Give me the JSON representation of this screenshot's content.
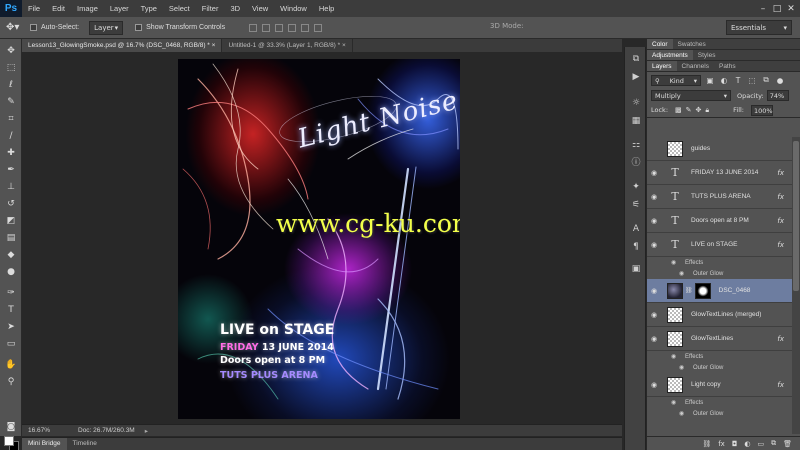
{
  "app": {
    "logo": "Ps",
    "menu": [
      "File",
      "Edit",
      "Image",
      "Layer",
      "Type",
      "Select",
      "Filter",
      "3D",
      "View",
      "Window",
      "Help"
    ],
    "window_controls": [
      "–",
      "□",
      "✕"
    ]
  },
  "options_bar": {
    "auto_select_label": "Auto-Select:",
    "auto_select_value": "Layer",
    "show_transform_label": "Show Transform Controls",
    "mode_3d_label": "3D Mode:",
    "workspace": "Essentials"
  },
  "document_tabs": [
    {
      "label": "Lesson13_GlowingSmoke.psd @ 16.7% (DSC_0468, RGB/8) *",
      "close": "×"
    },
    {
      "label": "Untitled-1 @ 33.3% (Layer 1, RGB/8) *",
      "close": "×"
    }
  ],
  "poster": {
    "title": "Light Noise",
    "watermark": "www.cg-ku.com",
    "line1": "LIVE on STAGE",
    "line2_accent": "FRIDAY",
    "line2_rest": " 13 JUNE 2014",
    "line3": "Doors open at 8 PM",
    "line4": "TUTS PLUS ARENA"
  },
  "status_bar": {
    "zoom": "16.67%",
    "doc_info": "Doc: 26.7M/260.3M"
  },
  "bottom_tabs": [
    "Mini Bridge",
    "Timeline"
  ],
  "panels": {
    "top_tabs": [
      "Color",
      "Swatches"
    ],
    "mid_tabs": [
      "Adjustments",
      "Styles"
    ],
    "layer_tabs": [
      "Layers",
      "Channels",
      "Paths"
    ],
    "kind": "Kind",
    "blend_mode": "Multiply",
    "opacity_label": "Opacity:",
    "opacity_value": "74%",
    "lock_label": "Lock:",
    "fill_label": "Fill:",
    "fill_value": "100%"
  },
  "layers": [
    {
      "name": "guides",
      "type": "pixel",
      "visible": false
    },
    {
      "name": "FRIDAY 13 JUNE 2014",
      "type": "text",
      "visible": true,
      "fx": "fx"
    },
    {
      "name": "TUTS PLUS ARENA",
      "type": "text",
      "visible": true,
      "fx": "fx"
    },
    {
      "name": "Doors open at 8 PM",
      "type": "text",
      "visible": true,
      "fx": "fx"
    },
    {
      "name": "LIVE on STAGE",
      "type": "text",
      "visible": true,
      "fx": "fx",
      "effects": [
        "Effects",
        "Outer Glow"
      ]
    },
    {
      "name": "DSC_0468",
      "type": "image",
      "visible": true,
      "selected": true
    },
    {
      "name": "GlowTextLines (merged)",
      "type": "pixel",
      "visible": true
    },
    {
      "name": "GlowTextLines",
      "type": "pixel",
      "visible": true,
      "fx": "fx",
      "effects": [
        "Effects",
        "Outer Glow"
      ]
    },
    {
      "name": "Light copy",
      "type": "pixel",
      "visible": true,
      "fx": "fx",
      "effects": [
        "Effects",
        "Outer Glow"
      ]
    }
  ],
  "colors": {
    "ui_dark": "#282828",
    "ui_panel": "#535353",
    "selected_layer": "#6d7da0",
    "watermark": "#f2ff4a",
    "friday_accent": "#ff6ce6"
  }
}
